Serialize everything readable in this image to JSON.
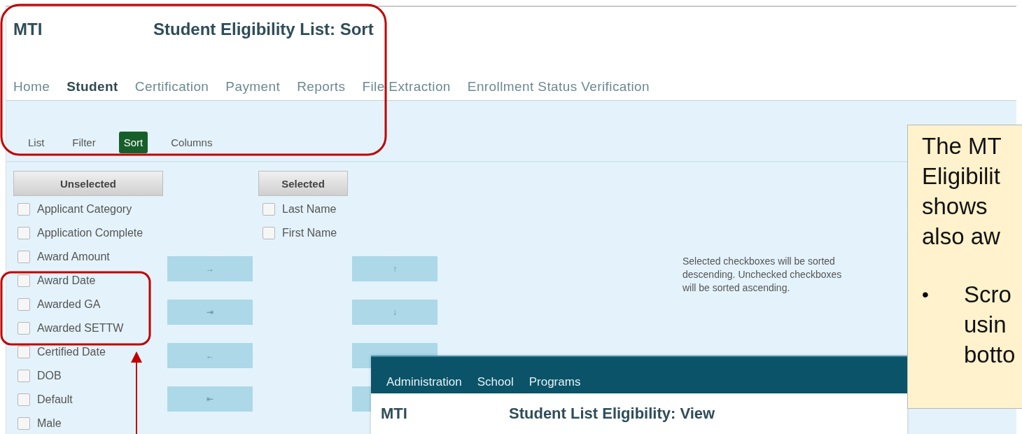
{
  "app": {
    "logo": "MTI",
    "title": "Student Eligibility List: Sort",
    "nav": [
      {
        "label": "Home",
        "selected": false
      },
      {
        "label": "Student",
        "selected": true
      },
      {
        "label": "Certification",
        "selected": false
      },
      {
        "label": "Payment",
        "selected": false
      },
      {
        "label": "Reports",
        "selected": false
      },
      {
        "label": "File Extraction",
        "selected": false
      },
      {
        "label": "Enrollment Status Verification",
        "selected": false
      }
    ],
    "subnav": [
      {
        "label": "List",
        "selected": false
      },
      {
        "label": "Filter",
        "selected": false
      },
      {
        "label": "Sort",
        "selected": true
      },
      {
        "label": "Columns",
        "selected": false
      }
    ],
    "unselected_header": "Unselected",
    "selected_header": "Selected",
    "unselected_items": [
      {
        "label": "Applicant Category",
        "checked": false
      },
      {
        "label": "Application Complete",
        "checked": false
      },
      {
        "label": "Award Amount",
        "checked": false
      },
      {
        "label": "Award Date",
        "checked": false
      },
      {
        "label": "Awarded GA",
        "checked": false
      },
      {
        "label": "Awarded SETTW",
        "checked": false
      },
      {
        "label": "Certified Date",
        "checked": false
      },
      {
        "label": "DOB",
        "checked": false
      },
      {
        "label": "Default",
        "checked": false
      },
      {
        "label": "Male",
        "checked": false
      }
    ],
    "selected_items": [
      {
        "label": "Last Name",
        "checked": false
      },
      {
        "label": "First Name",
        "checked": false
      }
    ],
    "move_buttons": [
      "→",
      "⇥",
      "←",
      "⇤"
    ],
    "order_buttons": [
      {
        "kind": "labeled",
        "label": "↑"
      },
      {
        "kind": "labeled",
        "label": "↓"
      },
      {
        "kind": "covered"
      },
      {
        "kind": "covered"
      }
    ],
    "note": "Selected checkboxes will be sorted descending. Unchecked checkboxes will be sorted ascending."
  },
  "overlay_window": {
    "menu": [
      "Administration",
      "School",
      "Programs"
    ],
    "logo": "MTI",
    "title": "Student List Eligibility: View"
  },
  "callout": {
    "lines": [
      "The MT",
      "Eligibilit",
      "shows",
      "also aw"
    ],
    "bullet": "•",
    "bullet_lines": [
      "Scro",
      "usin",
      "botto"
    ]
  }
}
